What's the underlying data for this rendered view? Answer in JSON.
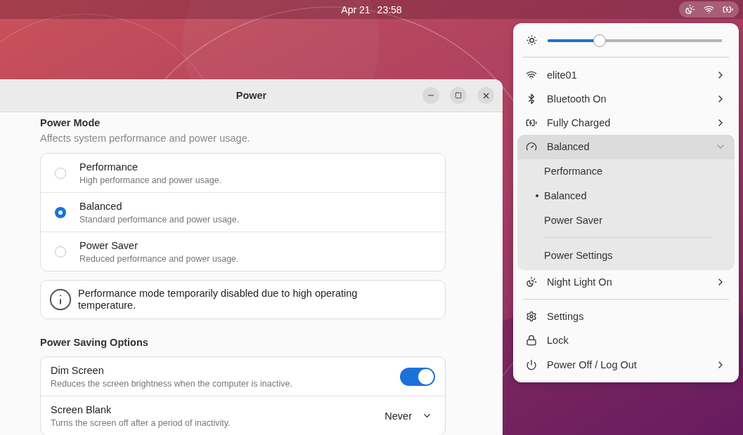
{
  "top_bar": {
    "date": "Apr 21",
    "time": "23:58"
  },
  "window": {
    "title": "Power",
    "power_mode": {
      "title": "Power Mode",
      "subtitle": "Affects system performance and power usage.",
      "options": [
        {
          "label": "Performance",
          "description": "High performance and power usage.",
          "selected": false
        },
        {
          "label": "Balanced",
          "description": "Standard performance and power usage.",
          "selected": true
        },
        {
          "label": "Power Saver",
          "description": "Reduced performance and power usage.",
          "selected": false
        }
      ],
      "notice": "Performance mode temporarily disabled due to high operating temperature."
    },
    "power_saving": {
      "title": "Power Saving Options",
      "rows": [
        {
          "kind": "switch",
          "label": "Dim Screen",
          "description": "Reduces the screen brightness when the computer is inactive.",
          "on": true
        },
        {
          "kind": "dropdown",
          "label": "Screen Blank",
          "description": "Turns the screen off after a period of inactivity.",
          "value": "Never"
        }
      ]
    }
  },
  "menu": {
    "brightness": {
      "level": 0.3
    },
    "items": [
      {
        "kind": "arrow",
        "label": "elite01"
      },
      {
        "kind": "arrow",
        "label": "Bluetooth On"
      },
      {
        "kind": "arrow",
        "label": "Fully Charged"
      },
      {
        "kind": "expander",
        "label": "Balanced",
        "expanded": true,
        "children": [
          {
            "label": "Performance",
            "selected": false
          },
          {
            "label": "Balanced",
            "selected": true
          },
          {
            "label": "Power Saver",
            "selected": false
          }
        ],
        "footer": "Power Settings"
      },
      {
        "kind": "arrow",
        "label": "Night Light On"
      }
    ],
    "system_items": [
      {
        "kind": "action",
        "label": "Settings"
      },
      {
        "kind": "action",
        "label": "Lock"
      },
      {
        "kind": "arrow",
        "label": "Power Off / Log Out"
      }
    ]
  }
}
